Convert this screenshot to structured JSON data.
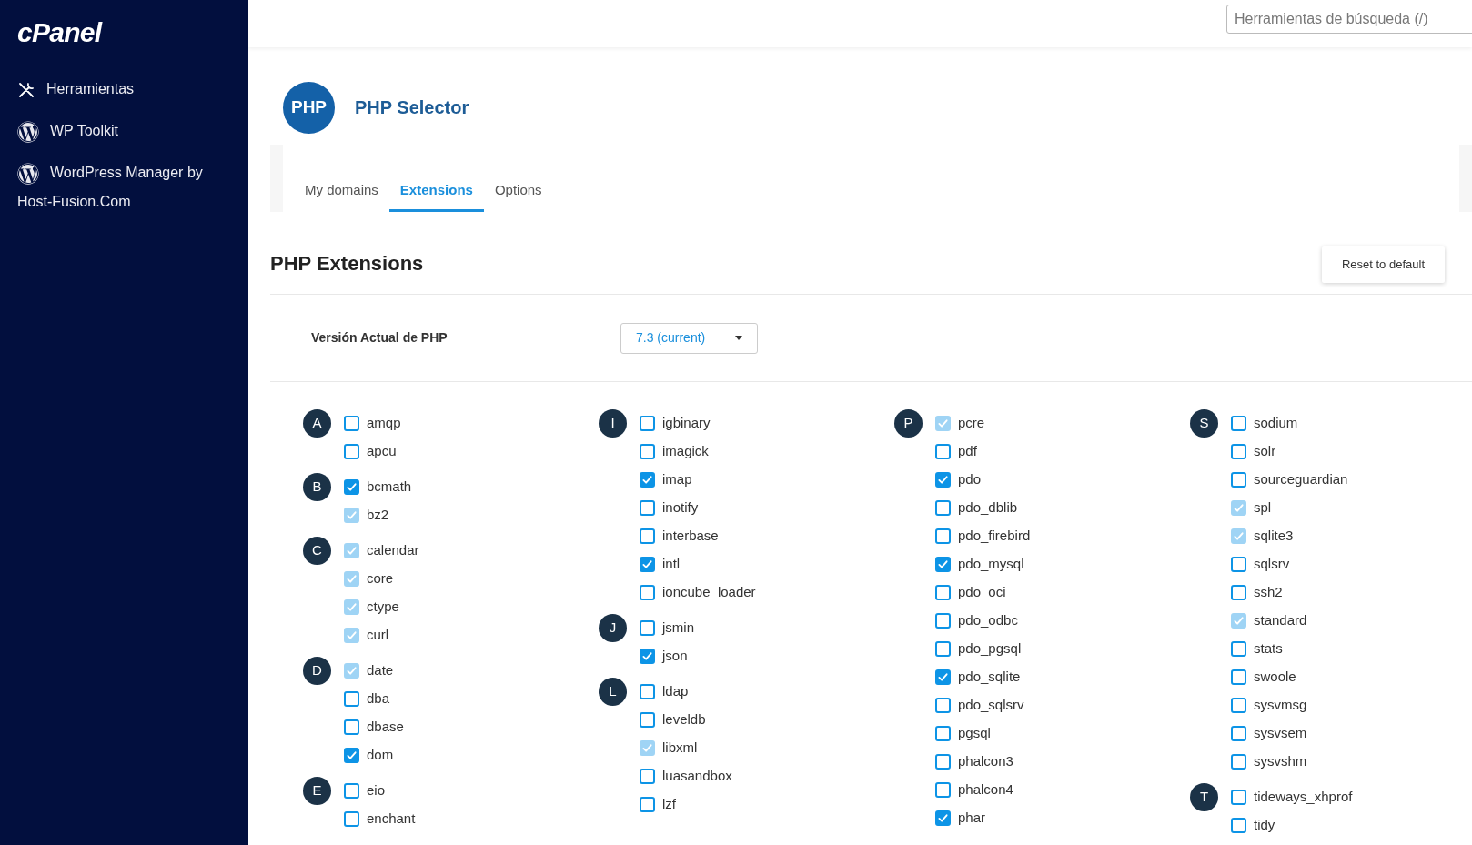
{
  "sidebar": {
    "logo": "cPanel",
    "items": [
      {
        "label": "Herramientas",
        "kind": "tools"
      },
      {
        "label": "WP Toolkit",
        "kind": "wordpress"
      },
      {
        "label": "WordPress Manager by Host-Fusion.Com",
        "kind": "wordpress"
      }
    ]
  },
  "search": {
    "placeholder": "Herramientas de búsqueda (/)"
  },
  "app": {
    "logo": "PHP",
    "title": "PHP Selector"
  },
  "tabs": [
    {
      "label": "My domains",
      "selected": false
    },
    {
      "label": "Extensions",
      "selected": true
    },
    {
      "label": "Options",
      "selected": false
    }
  ],
  "section": {
    "title": "PHP Extensions",
    "reset_button": "Reset to default",
    "version_label": "Versión Actual de PHP",
    "version_value": "7.3 (current)"
  },
  "columns": [
    [
      {
        "letter": "A",
        "items": [
          {
            "name": "amqp",
            "checked": false,
            "disabled": false
          },
          {
            "name": "apcu",
            "checked": false,
            "disabled": false
          }
        ]
      },
      {
        "letter": "B",
        "items": [
          {
            "name": "bcmath",
            "checked": true,
            "disabled": false
          },
          {
            "name": "bz2",
            "checked": true,
            "disabled": true
          }
        ]
      },
      {
        "letter": "C",
        "items": [
          {
            "name": "calendar",
            "checked": true,
            "disabled": true
          },
          {
            "name": "core",
            "checked": true,
            "disabled": true
          },
          {
            "name": "ctype",
            "checked": true,
            "disabled": true
          },
          {
            "name": "curl",
            "checked": true,
            "disabled": true
          }
        ]
      },
      {
        "letter": "D",
        "items": [
          {
            "name": "date",
            "checked": true,
            "disabled": true
          },
          {
            "name": "dba",
            "checked": false,
            "disabled": false
          },
          {
            "name": "dbase",
            "checked": false,
            "disabled": false
          },
          {
            "name": "dom",
            "checked": true,
            "disabled": false
          }
        ]
      },
      {
        "letter": "E",
        "items": [
          {
            "name": "eio",
            "checked": false,
            "disabled": false
          },
          {
            "name": "enchant",
            "checked": false,
            "disabled": false
          }
        ]
      }
    ],
    [
      {
        "letter": "I",
        "items": [
          {
            "name": "igbinary",
            "checked": false,
            "disabled": false
          },
          {
            "name": "imagick",
            "checked": false,
            "disabled": false
          },
          {
            "name": "imap",
            "checked": true,
            "disabled": false
          },
          {
            "name": "inotify",
            "checked": false,
            "disabled": false
          },
          {
            "name": "interbase",
            "checked": false,
            "disabled": false
          },
          {
            "name": "intl",
            "checked": true,
            "disabled": false
          },
          {
            "name": "ioncube_loader",
            "checked": false,
            "disabled": false
          }
        ]
      },
      {
        "letter": "J",
        "items": [
          {
            "name": "jsmin",
            "checked": false,
            "disabled": false
          },
          {
            "name": "json",
            "checked": true,
            "disabled": false
          }
        ]
      },
      {
        "letter": "L",
        "items": [
          {
            "name": "ldap",
            "checked": false,
            "disabled": false
          },
          {
            "name": "leveldb",
            "checked": false,
            "disabled": false
          },
          {
            "name": "libxml",
            "checked": true,
            "disabled": true
          },
          {
            "name": "luasandbox",
            "checked": false,
            "disabled": false
          },
          {
            "name": "lzf",
            "checked": false,
            "disabled": false
          }
        ]
      }
    ],
    [
      {
        "letter": "P",
        "items": [
          {
            "name": "pcre",
            "checked": true,
            "disabled": true
          },
          {
            "name": "pdf",
            "checked": false,
            "disabled": false
          },
          {
            "name": "pdo",
            "checked": true,
            "disabled": false
          },
          {
            "name": "pdo_dblib",
            "checked": false,
            "disabled": false
          },
          {
            "name": "pdo_firebird",
            "checked": false,
            "disabled": false
          },
          {
            "name": "pdo_mysql",
            "checked": true,
            "disabled": false
          },
          {
            "name": "pdo_oci",
            "checked": false,
            "disabled": false
          },
          {
            "name": "pdo_odbc",
            "checked": false,
            "disabled": false
          },
          {
            "name": "pdo_pgsql",
            "checked": false,
            "disabled": false
          },
          {
            "name": "pdo_sqlite",
            "checked": true,
            "disabled": false
          },
          {
            "name": "pdo_sqlsrv",
            "checked": false,
            "disabled": false
          },
          {
            "name": "pgsql",
            "checked": false,
            "disabled": false
          },
          {
            "name": "phalcon3",
            "checked": false,
            "disabled": false
          },
          {
            "name": "phalcon4",
            "checked": false,
            "disabled": false
          },
          {
            "name": "phar",
            "checked": true,
            "disabled": false
          }
        ]
      }
    ],
    [
      {
        "letter": "S",
        "items": [
          {
            "name": "sodium",
            "checked": false,
            "disabled": false
          },
          {
            "name": "solr",
            "checked": false,
            "disabled": false
          },
          {
            "name": "sourceguardian",
            "checked": false,
            "disabled": false
          },
          {
            "name": "spl",
            "checked": true,
            "disabled": true
          },
          {
            "name": "sqlite3",
            "checked": true,
            "disabled": true
          },
          {
            "name": "sqlsrv",
            "checked": false,
            "disabled": false
          },
          {
            "name": "ssh2",
            "checked": false,
            "disabled": false
          },
          {
            "name": "standard",
            "checked": true,
            "disabled": true
          },
          {
            "name": "stats",
            "checked": false,
            "disabled": false
          },
          {
            "name": "swoole",
            "checked": false,
            "disabled": false
          },
          {
            "name": "sysvmsg",
            "checked": false,
            "disabled": false
          },
          {
            "name": "sysvsem",
            "checked": false,
            "disabled": false
          },
          {
            "name": "sysvshm",
            "checked": false,
            "disabled": false
          }
        ]
      },
      {
        "letter": "T",
        "items": [
          {
            "name": "tideways_xhprof",
            "checked": false,
            "disabled": false
          },
          {
            "name": "tidy",
            "checked": false,
            "disabled": false
          }
        ]
      }
    ]
  ]
}
